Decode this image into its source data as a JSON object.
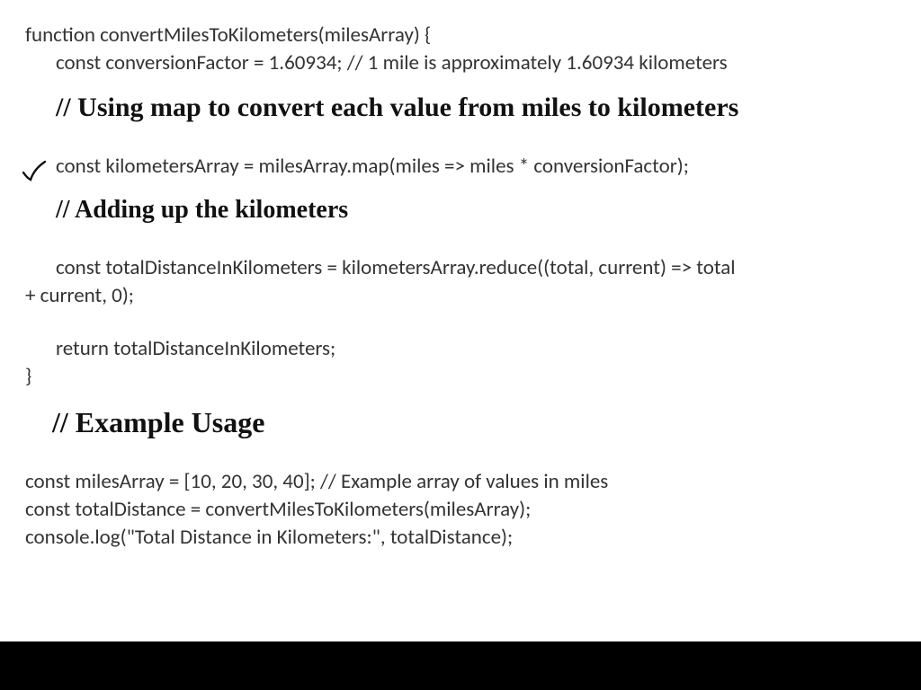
{
  "code": {
    "line1": "function convertMilesToKilometers(milesArray) {",
    "line2": "const conversionFactor = 1.60934; // 1 mile is approximately 1.60934 kilometers",
    "line3": "const kilometersArray = milesArray.map(miles => miles * conversionFactor);",
    "line4a": "const totalDistanceInKilometers = kilometersArray.reduce((total, current) => total",
    "line4b": "+ current, 0);",
    "line5": "return totalDistanceInKilometers;",
    "line6": "}",
    "line7": "const milesArray = [10, 20, 30, 40]; // Example array of values in miles",
    "line8": "const totalDistance = convertMilesToKilometers(milesArray);",
    "line9": "console.log(\"Total Distance in Kilometers:\", totalDistance);"
  },
  "handwriting": {
    "comment_map": "// Using map to convert each value from miles to kilometers",
    "comment_sum": "// Adding up the kilometers",
    "comment_example": "// Example Usage"
  }
}
